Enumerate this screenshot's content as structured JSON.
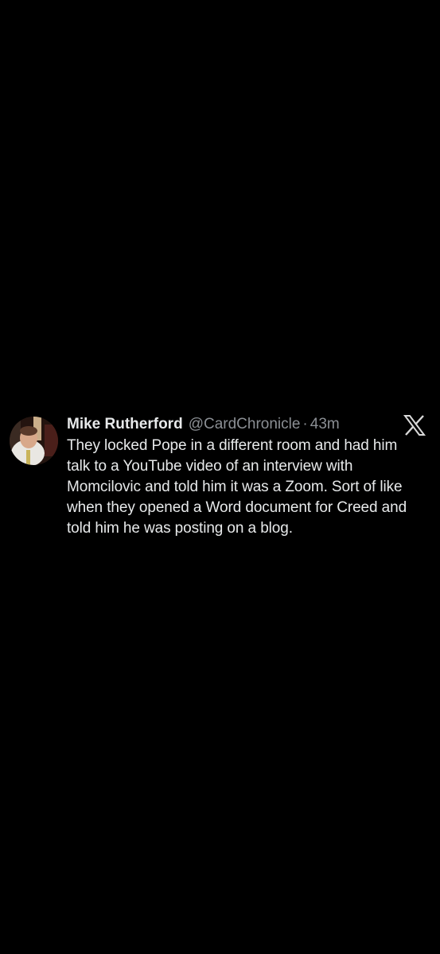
{
  "tweet": {
    "display_name": "Mike Rutherford",
    "handle": "@CardChronicle",
    "separator": "·",
    "time": "43m",
    "text": "They locked Pope in a different room and had him talk to a YouTube video of an interview with Momcilovic and told him it was a Zoom. Sort of like when they opened a Word document for Creed and told him he was posting on a blog."
  },
  "icons": {
    "platform": "x-logo-icon",
    "avatar": "profile-photo-avatar"
  },
  "colors": {
    "background": "#000000",
    "primary_text": "#e7e9ea",
    "secondary_text": "#8b8f94"
  }
}
